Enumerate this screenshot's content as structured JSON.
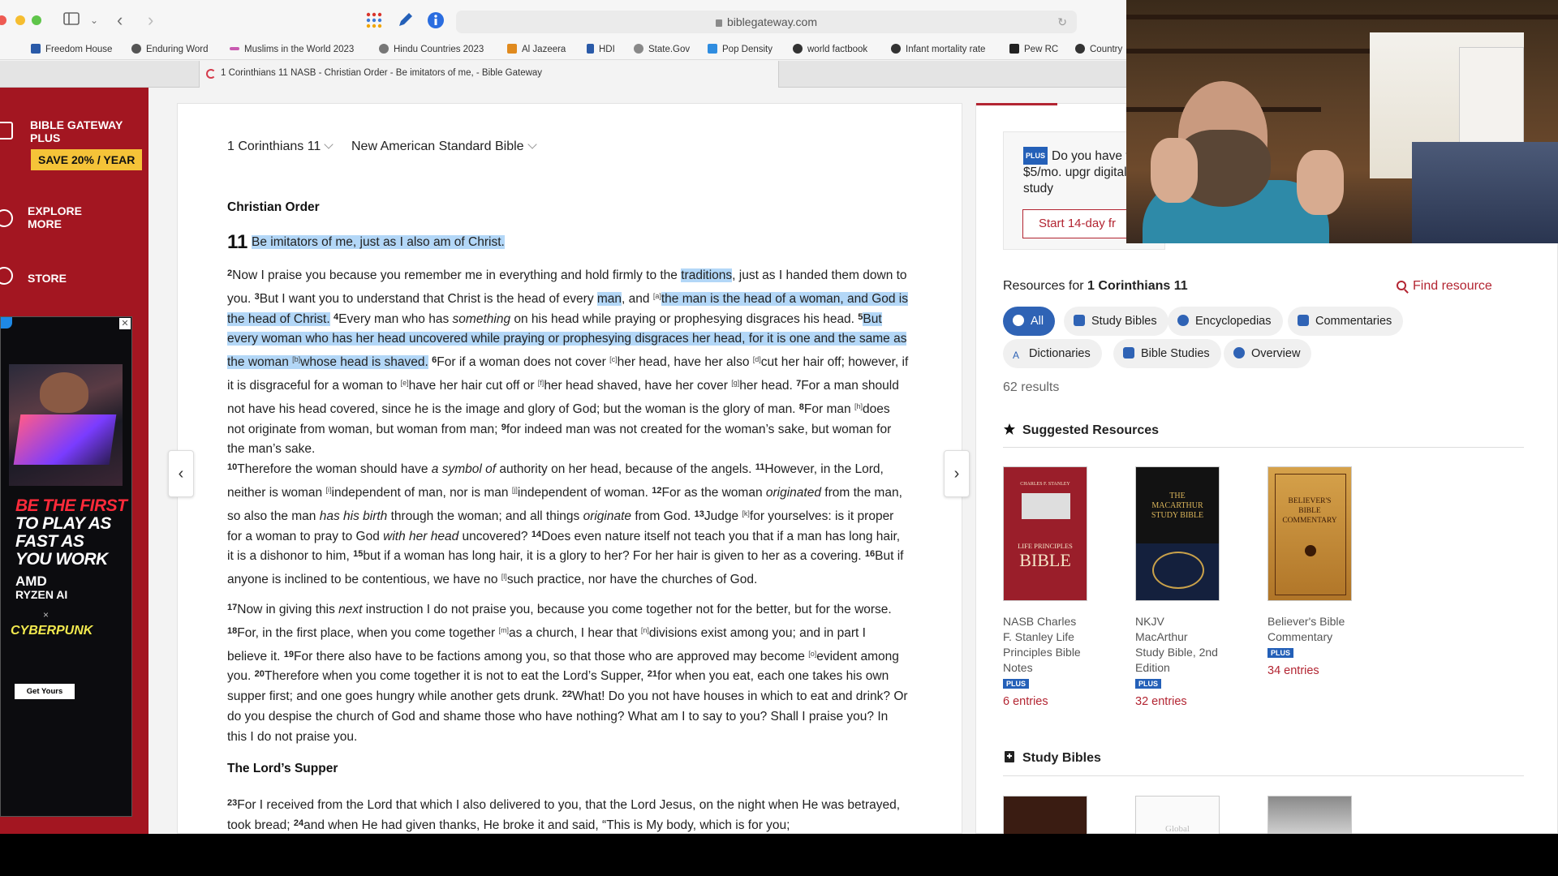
{
  "browser": {
    "url": "biblegateway.com",
    "tab_title": "1 Corinthians 11 NASB - Christian Order - Be imitators of me, - Bible Gateway",
    "bookmarks": [
      "Freedom House",
      "Enduring Word",
      "Muslims in the World 2023",
      "Hindu Countries 2023",
      "Al Jazeera",
      "HDI",
      "State.Gov",
      "Pop Density",
      "world factbook",
      "Infant mortality rate",
      "Pew RC",
      "Country"
    ]
  },
  "sidebar": {
    "plus_title": "BIBLE GATEWAY PLUS",
    "save_badge": "SAVE 20% / YEAR",
    "explore": "EXPLORE MORE",
    "store": "STORE"
  },
  "ad": {
    "headline_red": "BE THE FIRST",
    "headline_white": "TO PLAY AS FAST AS YOU WORK",
    "brand1": "AMD",
    "brand1_sub": "RYZEN AI",
    "times": "×",
    "brand2": "CYBERPUNK",
    "cta": "Get Yours"
  },
  "passage": {
    "book_chapter": "1 Corinthians 11",
    "version": "New American Standard Bible",
    "heading1": "Christian Order",
    "chapter_num": "11",
    "verse1": "Be imitators of me, just as I also am of Christ.",
    "heading2": "The Lord’s Supper"
  },
  "resources": {
    "plus_box_text": "Do you have than $5/mo. upgr digital Bible study",
    "plus_tag": "PLUS",
    "trial_button": "Start 14-day fr",
    "title_prefix": "Resources for ",
    "title_ref": "1 Corinthians 11",
    "find_resource": "Find resource",
    "filters": [
      "All",
      "Study Bibles",
      "Encyclopedias",
      "Commentaries",
      "Dictionaries",
      "Bible Studies",
      "Overview"
    ],
    "results": "62 results",
    "suggested_heading": "Suggested Resources",
    "study_bibles_heading": "Study Bibles",
    "books": [
      {
        "title": "NASB Charles F. Stanley Life Principles Bible Notes",
        "plus": "PLUS",
        "entries": "6 entries"
      },
      {
        "title": "NKJV MacArthur Study Bible, 2nd Edition",
        "plus": "PLUS",
        "entries": "32 entries"
      },
      {
        "title": "Believer's Bible Commentary",
        "plus": "PLUS",
        "entries": "34 entries"
      }
    ],
    "cover_texts": {
      "stanley_small": "CHARLES F. STANLEY",
      "stanley_main": "LIFE PRINCIPLES",
      "stanley_bible": "BIBLE",
      "macarthur_main": "THE MACARTHUR STUDY BIBLE",
      "believers_main": "BELIEVER'S BIBLE COMMENTARY",
      "global": "Global"
    }
  },
  "colors": {
    "brand_red": "#a31621",
    "highlight": "#b3d7f7",
    "link_red": "#b32532",
    "plus_blue": "#2460b8",
    "pill_active": "#2f63b5"
  }
}
